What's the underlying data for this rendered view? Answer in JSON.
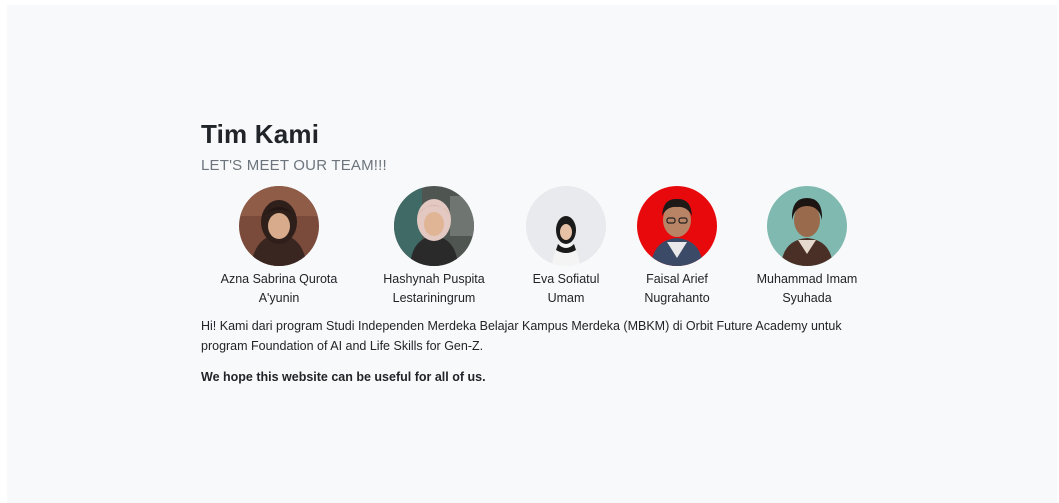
{
  "section": {
    "title": "Tim Kami",
    "subtitle": "LET'S MEET OUR TEAM!!!",
    "description": "Hi! Kami dari program Studi Independen Merdeka Belajar Kampus Merdeka (MBKM) di Orbit Future Academy untuk program Foundation of AI and Life Skills for Gen-Z.",
    "closing": "We hope this website can be useful for all of us."
  },
  "team": [
    {
      "name_line1": "Azna Sabrina Qurota",
      "name_line2": "A'yunin",
      "photo_bg": "#7a4a3a"
    },
    {
      "name_line1": "Hashynah Puspita",
      "name_line2": "Lestariningrum",
      "photo_bg": "#4f5551"
    },
    {
      "name_line1": "Eva Sofiatul",
      "name_line2": "Umam",
      "photo_bg": "#e9eaee"
    },
    {
      "name_line1": "Faisal Arief",
      "name_line2": "Nugrahanto",
      "photo_bg": "#e8090c"
    },
    {
      "name_line1": "Muhammad Imam",
      "name_line2": "Syuhada",
      "photo_bg": "#7fb9b0"
    }
  ]
}
